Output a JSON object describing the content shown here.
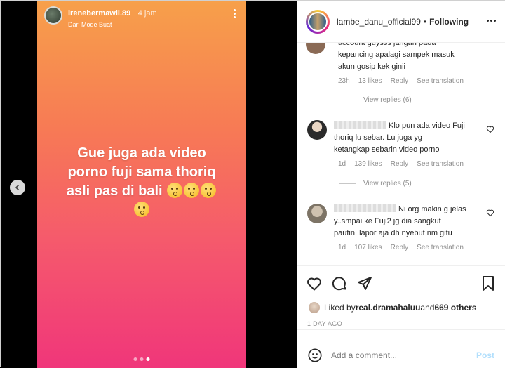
{
  "story": {
    "username": "irenebermawii.89",
    "time": "4 jam",
    "subtitle": "Dari Mode Buat",
    "lines": [
      "Gue juga ada video",
      "porno fuji sama thoriq",
      "asli  pas di bali"
    ]
  },
  "post": {
    "username": "lambe_danu_official99",
    "separator": "•",
    "follow_status": "Following"
  },
  "comments": [
    {
      "text_lines": [
        "account guysss jangan pada",
        "kepancing apalagi sampek masuk",
        "akun gosip kek ginii"
      ],
      "time": "23h",
      "likes": "13 likes",
      "reply": "Reply",
      "translate": "See translation",
      "view_replies": "View replies (6)"
    },
    {
      "text_lines": [
        "Klo pun ada video Fuji",
        "thoriq lu sebar. Lu juga yg",
        "ketangkap sebarin video porno"
      ],
      "time": "1d",
      "likes": "139 likes",
      "reply": "Reply",
      "translate": "See translation",
      "view_replies": "View replies (5)"
    },
    {
      "text_lines": [
        "Ni org makin g jelas",
        "y..smpai ke Fuji2 jg dia sangkut",
        "pautin..lapor aja dh nyebut nm gitu"
      ],
      "time": "1d",
      "likes": "107 likes",
      "reply": "Reply",
      "translate": "See translation"
    }
  ],
  "likes": {
    "prefix": "Liked by ",
    "user": "real.dramahaluu",
    "middle": " and ",
    "others": "669 others"
  },
  "date": "1 DAY AGO",
  "add_comment": {
    "placeholder": "Add a comment...",
    "post_label": "Post"
  },
  "colors": {
    "story_gradient_top": "#f7a04a",
    "story_gradient_bottom": "#f0367a",
    "post_button": "#b2dffc"
  }
}
